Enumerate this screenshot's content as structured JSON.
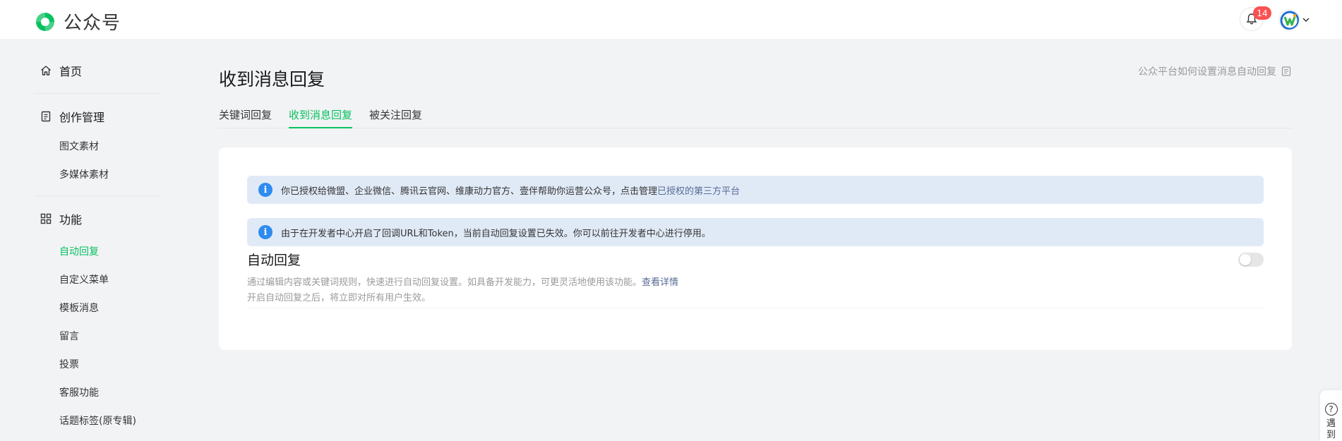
{
  "header": {
    "brand": "公众号",
    "notification_count": "14"
  },
  "sidebar": {
    "home": "首页",
    "creation": {
      "label": "创作管理",
      "items": [
        "图文素材",
        "多媒体素材"
      ]
    },
    "features": {
      "label": "功能",
      "items": [
        "自动回复",
        "自定义菜单",
        "模板消息",
        "留言",
        "投票",
        "客服功能",
        "话题标签(原专辑)"
      ],
      "active_index": 0
    }
  },
  "main": {
    "title": "收到消息回复",
    "help_link": "公众平台如何设置消息自动回复",
    "tabs": [
      {
        "label": "关键词回复",
        "active": false
      },
      {
        "label": "收到消息回复",
        "active": true
      },
      {
        "label": "被关注回复",
        "active": false
      }
    ],
    "notices": [
      {
        "text": "你已授权给微盟、企业微信、腾讯云官网、维康动力官方、壹伴帮助你运营公众号，点击管理",
        "link": "已授权的第三方平台"
      },
      {
        "text": "由于在开发者中心开启了回调URL和Token，当前自动回复设置已失效。你可以前往开发者中心进行停用。",
        "link": ""
      }
    ],
    "auto_reply": {
      "title": "自动回复",
      "desc_line1": "通过编辑内容或关键词规则，快速进行自动回复设置。如具备开发能力，可更灵活地使用该功能。",
      "desc_link": "查看详情",
      "desc_line2": "开启自动回复之后，将立即对所有用户生效。",
      "enabled": false
    }
  },
  "float_help": {
    "icon_text": "?",
    "text": "遇到"
  },
  "colors": {
    "accent": "#07c160",
    "link": "#576b95",
    "badge": "#fa5151",
    "info": "#2e8cf0",
    "notice_bg": "#e0eaf7"
  }
}
